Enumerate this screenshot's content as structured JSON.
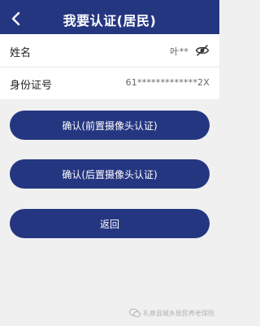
{
  "header": {
    "title": "我要认证(居民)",
    "back_icon": "chevron-left-icon",
    "background": "#253681"
  },
  "fields": {
    "name": {
      "label": "姓名",
      "value": "叶**",
      "toggle_icon": "eye-slash-icon"
    },
    "id_number": {
      "label": "身份证号",
      "value": "61*************2X"
    }
  },
  "buttons": {
    "front_camera": "确认(前置摄像头认证)",
    "rear_camera": "确认(后置摄像头认证)",
    "back": "返回",
    "color": "#253681"
  },
  "watermark": {
    "text": "礼泉县城乡居民养老保险",
    "icon": "wechat-icon"
  }
}
